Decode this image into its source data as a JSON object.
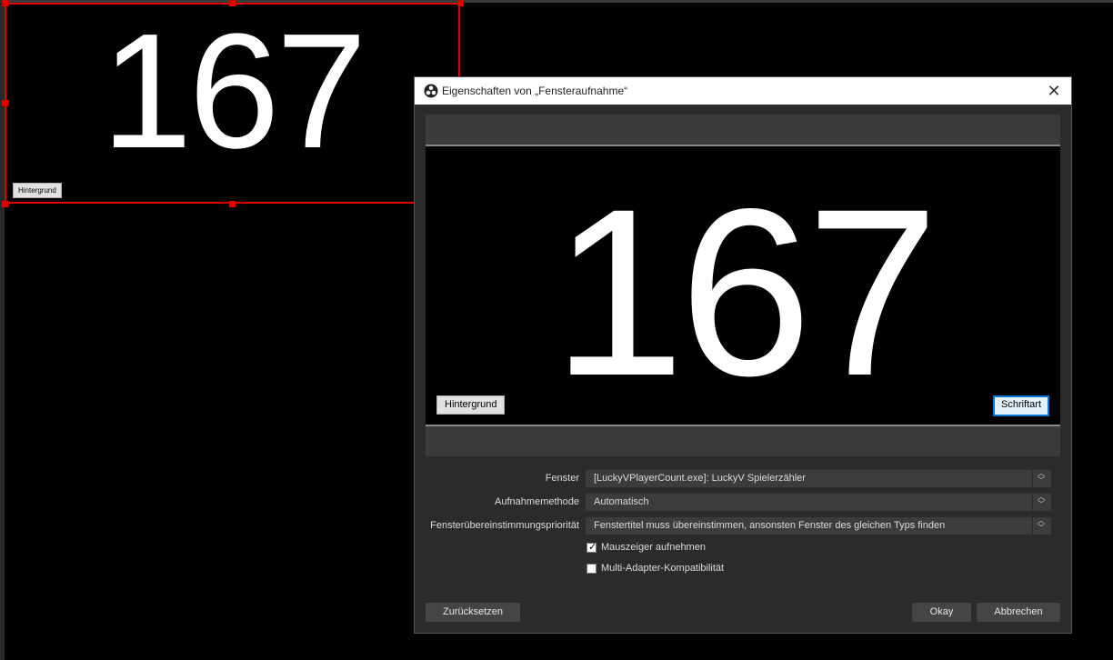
{
  "canvas": {
    "counter_value": "167",
    "button_label": "Hintergrund"
  },
  "dialog": {
    "title": "Eigenschaften von „Fensteraufnahme“",
    "preview": {
      "counter_value": "167",
      "left_button": "Hintergrund",
      "right_button": "Schriftart"
    },
    "properties": [
      {
        "label": "Fenster",
        "value": "[LuckyVPlayerCount.exe]: LuckyV Spielerzähler"
      },
      {
        "label": "Aufnahmemethode",
        "value": "Automatisch"
      },
      {
        "label": "Fensterübereinstimmungspriorität",
        "value": "Fenstertitel muss übereinstimmen, ansonsten Fenster des gleichen Typs finden"
      }
    ],
    "checkboxes": [
      {
        "label": "Mauszeiger aufnehmen",
        "checked": true
      },
      {
        "label": "Multi-Adapter-Kompatibilität",
        "checked": false
      }
    ],
    "buttons": {
      "reset": "Zurücksetzen",
      "ok": "Okay",
      "cancel": "Abbrechen"
    }
  },
  "icons": {
    "title_logo": "obs-logo-icon",
    "close": "close-icon",
    "combo_arrows": "updown-arrows-icon",
    "check": "checkmark-icon"
  },
  "colors": {
    "selection": "#e00000",
    "dialog_bg": "#2b2b2b",
    "focus": "#0078d7"
  }
}
